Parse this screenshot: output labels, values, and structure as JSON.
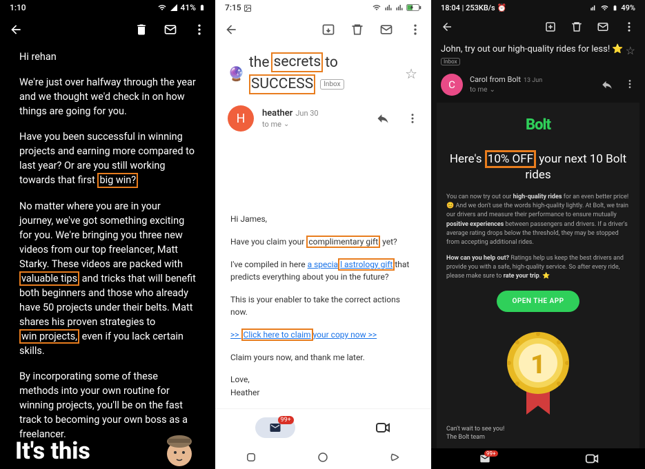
{
  "screen1": {
    "status": {
      "time": "1:10",
      "battery": "41%"
    },
    "body": {
      "greeting": "Hi rehan",
      "p1": "We're just over halfway through the year and we thought we'd check in on how things are going for you.",
      "p2a": "Have you been successful in winning projects and earning more compared to last year? Or are you still working towards that first ",
      "p2_hl": "big win?",
      "p3a": "No matter where you are in your journey, we've got something exciting for you. We're bringing you three new videos from our top freelancer, Matt Starky. These videos are packed with ",
      "p3_hl1": "valuable tips",
      "p3b": " and tricks that will benefit both beginners and those who already have 50 projects under their belts. Matt shares his proven strategies to ",
      "p3_hl2": "win projects,",
      "p3c": " even if you lack certain skills.",
      "p4": "By incorporating some of these methods into your own routine for winning projects, you'll be on the fast track to becoming your own boss as a freelancer.",
      "footer_text": "It's this"
    }
  },
  "screen2": {
    "status": {
      "time": "7:15"
    },
    "subject": {
      "pre": "the",
      "hl1": "secrets",
      "mid": "to",
      "hl2": "SUCCESS",
      "tag": "Inbox"
    },
    "sender": {
      "initial": "H",
      "name": "heather",
      "date": "Jun 30",
      "to": "to me"
    },
    "msg": {
      "greet": "Hi James,",
      "l1a": "Have you claim your ",
      "l1_hl": "complimentary gift",
      "l1b": " yet?",
      "l2a": "I've compiled in here ",
      "l2_link1": "a specia",
      "l2_hl": "l astrology gift ",
      "l2b": "that predicts everything about you in the future?",
      "l3": "This is your enabler to take the correct actions now.",
      "l4_arrow": ">> ",
      "l4_hl": "Click here to claim ",
      "l4_rest": "your copy now >>",
      "l5": "Claim yours now, and thank me later.",
      "sig1": "Love,",
      "sig2": "Heather"
    },
    "nav": {
      "badge": "99+"
    }
  },
  "screen3": {
    "status": {
      "left": "18:04 | 253KB/s",
      "battery": "49%"
    },
    "subject": {
      "text": "John, try out our high-quality rides for less! ⭐",
      "tag": "Inbox"
    },
    "sender": {
      "initial": "C",
      "name": "Carol from Bolt",
      "date": "13 Jun",
      "to": "to me"
    },
    "brand": "Bolt",
    "headline": {
      "pre": "Here's ",
      "hl": "10% OFF",
      "post": " your next 10 Bolt rides"
    },
    "fine1a": "You can now try out our ",
    "fine1b": "high-quality rides",
    "fine1c": " for an even better price! 😊 And we don't use the words high-quality lightly. At Bolt, we train our drivers and measure their performance to ensure mutually ",
    "fine1d": "positive experiences",
    "fine1e": " between passengers and drivers. If a driver's average rating drops below the threshold, they may be stopped from accepting additional rides.",
    "fine2a": "How can you help out?",
    "fine2b": " Ratings help us keep the best drivers and provide you with a safe, high-quality service. So after every ride, please make sure to ",
    "fine2c": "rate your trip",
    "fine2d": ". ⭐",
    "cta": "OPEN THE APP",
    "footer1": "Can't wait to see you!",
    "footer2": "The Bolt team",
    "nav": {
      "badge": "99+"
    }
  }
}
